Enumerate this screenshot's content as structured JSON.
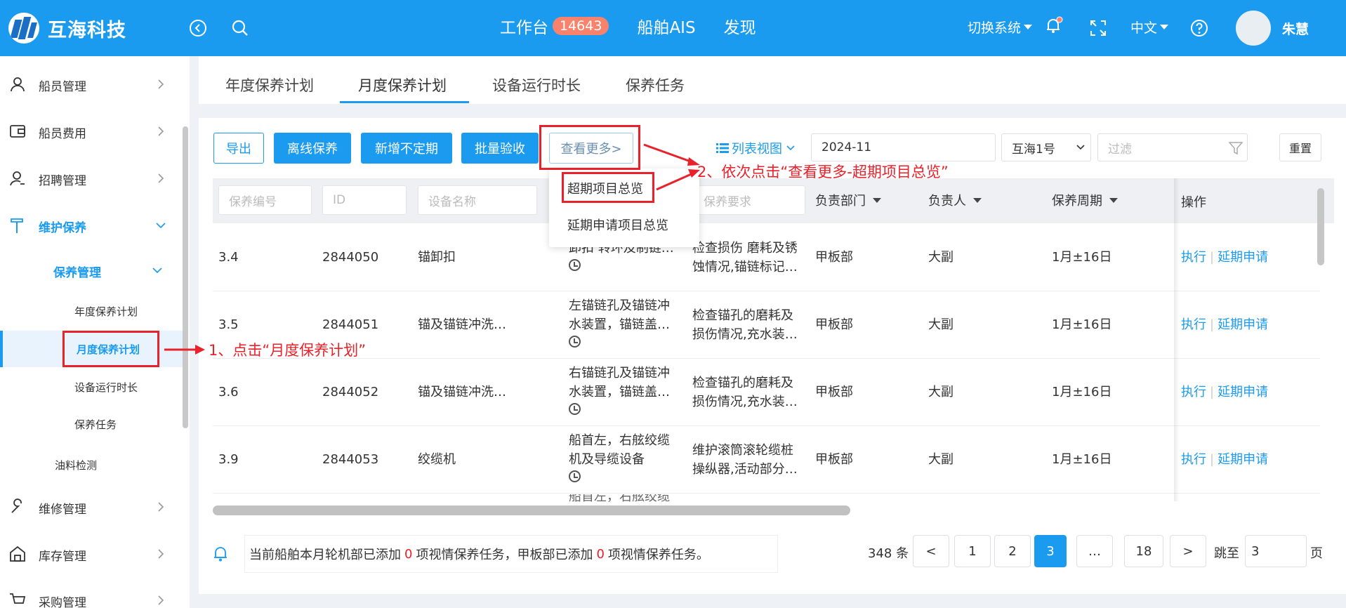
{
  "header": {
    "logo_text": "互海科技",
    "nav": {
      "workbench": "工作台",
      "workbench_badge": "14643",
      "ais": "船舶AIS",
      "discover": "发现"
    },
    "switch_system": "切换系统",
    "language": "中文",
    "user_name": "朱慧",
    "colors": {
      "primary": "#1a9bf0",
      "badge": "#f9826c"
    }
  },
  "sidebar": {
    "items": [
      {
        "label": "船员管理",
        "icon": "user-icon"
      },
      {
        "label": "船员费用",
        "icon": "wallet-icon"
      },
      {
        "label": "招聘管理",
        "icon": "recruit-icon"
      },
      {
        "label": "维护保养",
        "icon": "hammer-icon"
      },
      {
        "label": "维修管理",
        "icon": "wrench-icon"
      },
      {
        "label": "库存管理",
        "icon": "warehouse-icon"
      },
      {
        "label": "采购管理",
        "icon": "cart-icon"
      }
    ],
    "sub_group": "保养管理",
    "sub_items": [
      "年度保养计划",
      "月度保养计划",
      "设备运行时长",
      "保养任务"
    ],
    "oil": "油料检测"
  },
  "tabs": [
    "年度保养计划",
    "月度保养计划",
    "设备运行时长",
    "保养任务"
  ],
  "toolbar": {
    "export": "导出",
    "offline": "离线保养",
    "add_irregular": "新增不定期",
    "batch_accept": "批量验收",
    "more": "查看更多>",
    "view_toggle": "列表视图",
    "month": "2024-11",
    "ship": "互海1号",
    "filter_placeholder": "过滤",
    "reset": "重置"
  },
  "dropdown": [
    "超期项目总览",
    "延期申请项目总览"
  ],
  "table": {
    "filters": [
      "保养编号",
      "ID",
      "设备名称",
      "保养要求"
    ],
    "headers": {
      "dept": "负责部门",
      "owner": "负责人",
      "cycle": "保养周期",
      "op": "操作"
    },
    "rows": [
      {
        "code": "3.4",
        "id": "2844050",
        "device": "锚卸扣",
        "content": "卸扣 转环及制链…",
        "req": "检查损伤 磨耗及锈蚀情况,锚链标记…",
        "dept": "甲板部",
        "owner": "大副",
        "cycle": "1月±16日"
      },
      {
        "code": "3.5",
        "id": "2844051",
        "device": "锚及锚链冲洗…",
        "content": "左锚链孔及锚链冲水装置，锚链盖…",
        "req": "检查锚孔的磨耗及损伤情况,充水装…",
        "dept": "甲板部",
        "owner": "大副",
        "cycle": "1月±16日"
      },
      {
        "code": "3.6",
        "id": "2844052",
        "device": "锚及锚链冲洗…",
        "content": "右锚链孔及锚链冲水装置，锚链盖…",
        "req": "检查锚孔的磨耗及损伤情况,充水装…",
        "dept": "甲板部",
        "owner": "大副",
        "cycle": "1月±16日"
      },
      {
        "code": "3.9",
        "id": "2844053",
        "device": "绞缆机",
        "content": "船首左，右舷绞缆机及导缆设备",
        "req": "维护滚筒滚轮缆桩操纵器,活动部分…",
        "dept": "甲板部",
        "owner": "大副",
        "cycle": "1月±16日"
      }
    ],
    "partial_row": "船首左，右舷绞缆",
    "actions": {
      "execute": "执行",
      "delay": "延期申请"
    }
  },
  "footer": {
    "notice_a": "当前船舶本月轮机部已添加",
    "count_a": "0",
    "notice_b": "项视情保养任务，甲板部已添加",
    "count_b": "0",
    "notice_c": "项视情保养任务。",
    "total": "348 条",
    "pages": [
      "1",
      "2",
      "3",
      "…",
      "18"
    ],
    "prev": "<",
    "next": ">",
    "jump_label": "跳至",
    "jump_value": "3",
    "page_unit": "页"
  },
  "annotations": {
    "step1": "1、点击“月度保养计划”",
    "step2": "2、依次点击“查看更多-超期项目总览”"
  }
}
